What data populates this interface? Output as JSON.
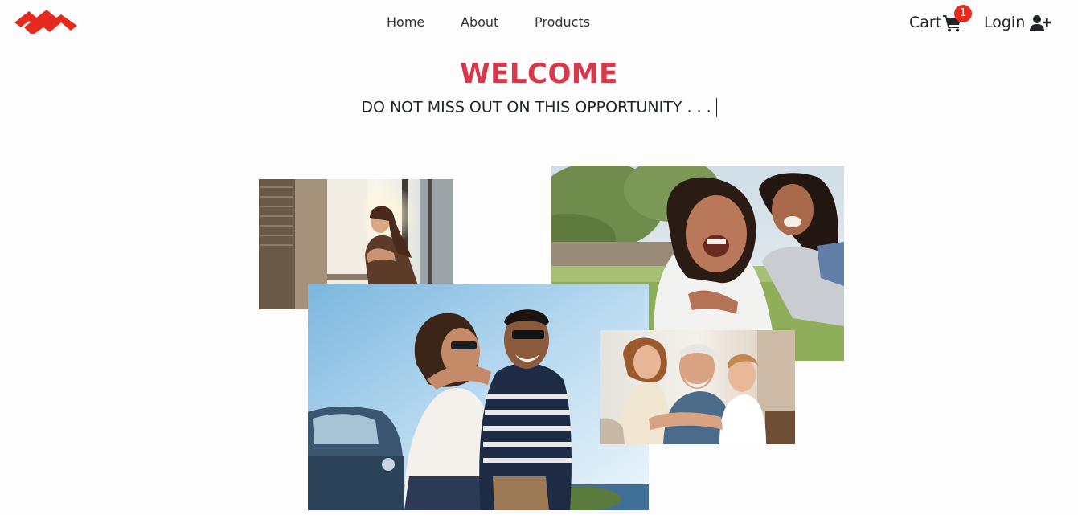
{
  "header": {
    "logo": "brand-logo",
    "nav": {
      "home": "Home",
      "about": "About",
      "products": "Products"
    },
    "cart": {
      "label": "Cart",
      "icon": "cart-icon",
      "count": "1"
    },
    "login": {
      "label": "Login",
      "icon": "user-plus-icon"
    }
  },
  "hero": {
    "title": "WELCOME",
    "tagline": "DO NOT MISS OUT ON THIS OPPORTUNITY . . ."
  },
  "gallery": [
    "woman-window-photo",
    "mother-daughter-photo",
    "couple-car-photo",
    "grandfather-children-photo"
  ],
  "colors": {
    "brand": "#e52a1e",
    "title": "#d63a4a",
    "text": "#212529",
    "background": "#fdfdfd"
  }
}
